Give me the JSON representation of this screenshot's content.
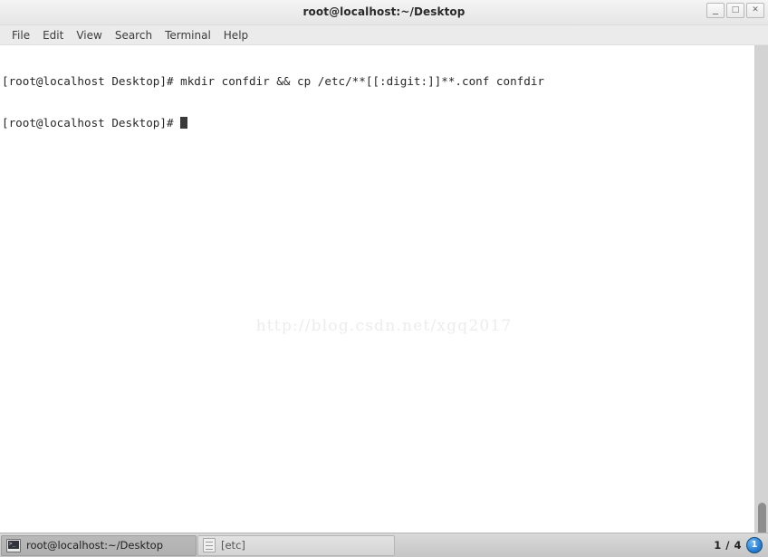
{
  "window": {
    "title": "root@localhost:~/Desktop",
    "controls": [
      {
        "name": "minimize",
        "glyph": "_"
      },
      {
        "name": "maximize",
        "glyph": "□"
      },
      {
        "name": "close",
        "glyph": "✕"
      }
    ]
  },
  "menu": {
    "items": [
      {
        "label": "File"
      },
      {
        "label": "Edit"
      },
      {
        "label": "View"
      },
      {
        "label": "Search"
      },
      {
        "label": "Terminal"
      },
      {
        "label": "Help"
      }
    ]
  },
  "terminal": {
    "prompt": "[root@localhost Desktop]# ",
    "lines": [
      "[root@localhost Desktop]# mkdir confdir && cp /etc/**[[:digit:]]**.conf confdir"
    ],
    "current_line": "[root@localhost Desktop]# ",
    "watermark": "http://blog.csdn.net/xgq2017",
    "text_color": "#272727",
    "background_color": "#ffffff"
  },
  "taskbar": {
    "tasks": [
      {
        "label": "root@localhost:~/Desktop",
        "icon": "terminal-icon",
        "active": true
      },
      {
        "label": "[etc]",
        "icon": "file-manager-icon",
        "active": false
      }
    ],
    "workspace_counter": "1 / 4",
    "workspace_current": "1",
    "accent_color": "#2a7fd4"
  }
}
